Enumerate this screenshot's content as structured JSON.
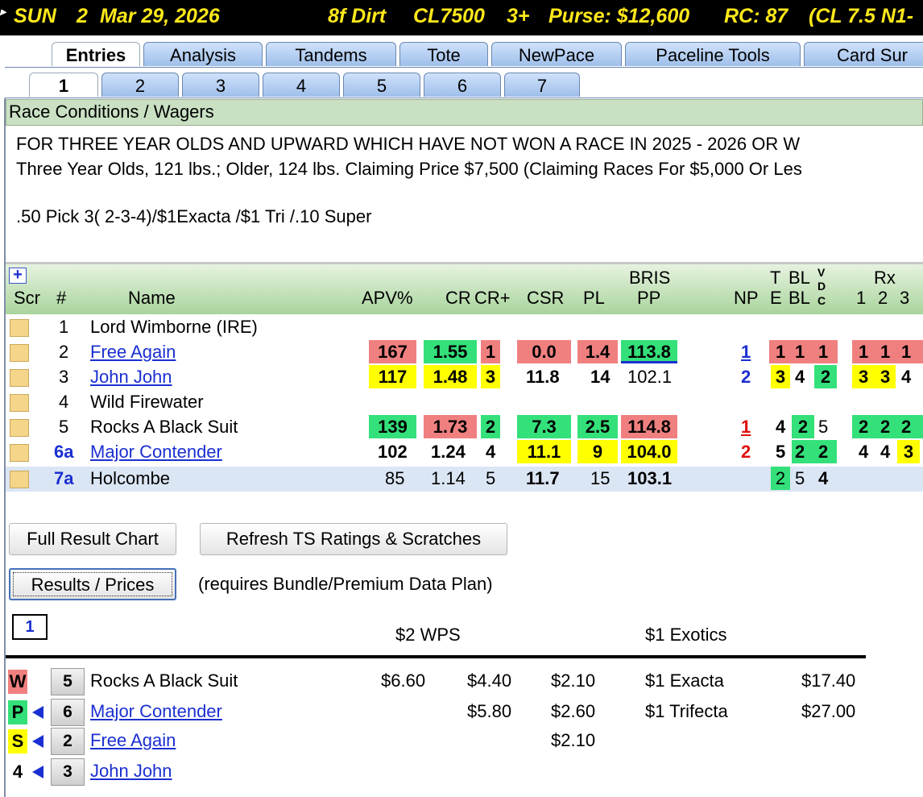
{
  "header": {
    "day": "SUN",
    "race_no": "2",
    "date": "Mar 29, 2026",
    "distance_surface": "8f Dirt",
    "race_class": "CL7500",
    "age": "3+",
    "purse": "Purse: $12,600",
    "rc": "RC: 87",
    "cond_code": "(CL 7.5 N1-"
  },
  "main_tabs": [
    "Entries",
    "Analysis",
    "Tandems",
    "Tote",
    "NewPace",
    "Paceline Tools",
    "Card Sur"
  ],
  "race_tabs": [
    "1",
    "2",
    "3",
    "4",
    "5",
    "6",
    "7"
  ],
  "conditions": {
    "heading": "Race Conditions / Wagers",
    "line1": "FOR THREE YEAR OLDS AND UPWARD WHICH HAVE NOT WON A RACE IN 2025 - 2026 OR W",
    "line2": "Three Year Olds, 121 lbs.; Older, 124 lbs. Claiming Price $7,500 (Claiming Races For $5,000 Or Les",
    "wagers": ".50 Pick 3( 2-3-4)/$1Exacta /$1 Tri /.10 Super"
  },
  "grid": {
    "plus": "+",
    "headers": {
      "scr": "Scr",
      "num": "#",
      "name": "Name",
      "apv": "APV%",
      "cr": "CR",
      "crplus": "CR+",
      "csr": "CSR",
      "pl": "PL",
      "bris1": "BRIS",
      "bris2": "PP",
      "np": "NP",
      "te_t": "T",
      "te_e": "E",
      "bl1": "BL",
      "bl2": "BL",
      "vdc_v": "V",
      "vdc_d": "D",
      "vdc_c": "C",
      "rx": "Rx",
      "rx1": "1",
      "rx2": "2",
      "rx3": "3"
    },
    "rows": [
      {
        "num": "1",
        "name": "Lord Wimborne (IRE)"
      },
      {
        "num": "2",
        "name": "Free Again",
        "apv": "167",
        "cr": "1.55",
        "crplus": "1",
        "csr": "0.0",
        "pl": "1.4",
        "bris": "113.8",
        "np": "1",
        "te": "1",
        "bl": "1",
        "vdc": "1",
        "rx1": "1",
        "rx2": "1",
        "rx3": "1"
      },
      {
        "num": "3",
        "name": "John John",
        "apv": "117",
        "cr": "1.48",
        "crplus": "3",
        "csr": "11.8",
        "pl": "14",
        "bris": "102.1",
        "np": "2",
        "te": "3",
        "bl": "4",
        "vdc": "2",
        "rx1": "3",
        "rx2": "3",
        "rx3": "4"
      },
      {
        "num": "4",
        "name": "Wild Firewater"
      },
      {
        "num": "5",
        "name": "Rocks A Black Suit",
        "apv": "139",
        "cr": "1.73",
        "crplus": "2",
        "csr": "7.3",
        "pl": "2.5",
        "bris": "114.8",
        "np": "1",
        "te": "4",
        "bl": "2",
        "vdc": "5",
        "rx1": "2",
        "rx2": "2",
        "rx3": "2"
      },
      {
        "num": "6a",
        "name": "Major Contender",
        "apv": "102",
        "cr": "1.24",
        "crplus": "4",
        "csr": "11.1",
        "pl": "9",
        "bris": "104.0",
        "np": "2",
        "te": "5",
        "bl": "2",
        "vdc": "2",
        "rx1": "4",
        "rx2": "4",
        "rx3": "3"
      },
      {
        "num": "7a",
        "name": "Holcombe",
        "apv": "85",
        "cr": "1.14",
        "crplus": "5",
        "csr": "11.7",
        "pl": "15",
        "bris": "103.1",
        "te": "2",
        "bl": "5",
        "vdc": "4"
      }
    ]
  },
  "buttons": {
    "full_result": "Full Result Chart",
    "refresh": "Refresh TS Ratings & Scratches",
    "results_prices": "Results / Prices",
    "requires": "(requires Bundle/Premium Data Plan)"
  },
  "results": {
    "race_box": "1",
    "wps_header": "$2 WPS",
    "exotics_header": "$1 Exotics",
    "finishers": [
      {
        "pos": "W",
        "num": "5",
        "name": "Rocks A Black Suit",
        "win": "$6.60",
        "place": "$4.40",
        "show": "$2.10",
        "color": "#f08080"
      },
      {
        "pos": "P",
        "num": "6",
        "name": "Major Contender",
        "place": "$5.80",
        "show": "$2.60",
        "color": "#34e07a"
      },
      {
        "pos": "S",
        "num": "2",
        "name": "Free Again",
        "show": "$2.10",
        "color": "#ffff00"
      },
      {
        "pos": "4",
        "num": "3",
        "name": "John John",
        "color": "#ffffff"
      }
    ],
    "exotics": [
      {
        "label": "$1 Exacta",
        "amount": "$17.40"
      },
      {
        "label": "$1 Trifecta",
        "amount": "$27.00"
      }
    ]
  },
  "colors": {
    "green": "#34e07a",
    "red": "#f08080",
    "yellow": "#ffff00",
    "link": "#1a2fd1"
  }
}
